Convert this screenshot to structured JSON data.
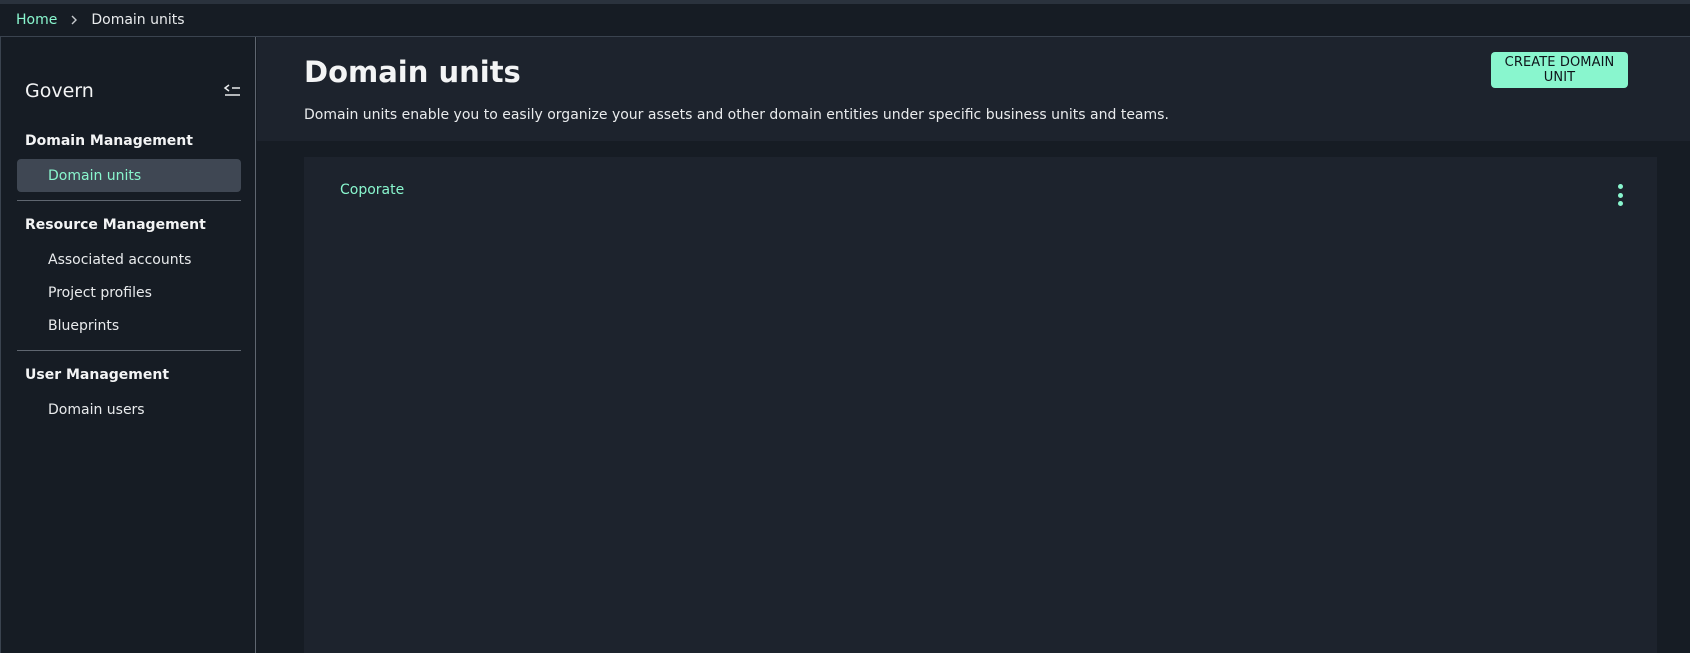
{
  "breadcrumb": {
    "home": "Home",
    "separator": "›",
    "current": "Domain units"
  },
  "sidebar": {
    "title": "Govern",
    "sections": [
      {
        "heading": "Domain Management",
        "items": [
          "Domain units"
        ]
      },
      {
        "heading": "Resource Management",
        "items": [
          "Associated accounts",
          "Project profiles",
          "Blueprints"
        ]
      },
      {
        "heading": "User Management",
        "items": [
          "Domain users"
        ]
      }
    ],
    "active_item": "Domain units"
  },
  "header": {
    "title": "Domain units",
    "description": "Domain units enable you to easily organize your assets and other domain entities under specific business units and teams.",
    "create_button": "CREATE DOMAIN UNIT"
  },
  "tree": {
    "items": [
      "Coporate"
    ]
  },
  "colors": {
    "accent": "#89f6ce",
    "background": "#161c24",
    "panel": "#1d232d",
    "active_item_bg": "#3f4753"
  },
  "icons": {
    "collapse": "collapse-sidebar-icon",
    "more": "more-vertical-icon",
    "breadcrumb_separator": "chevron-right-icon"
  }
}
